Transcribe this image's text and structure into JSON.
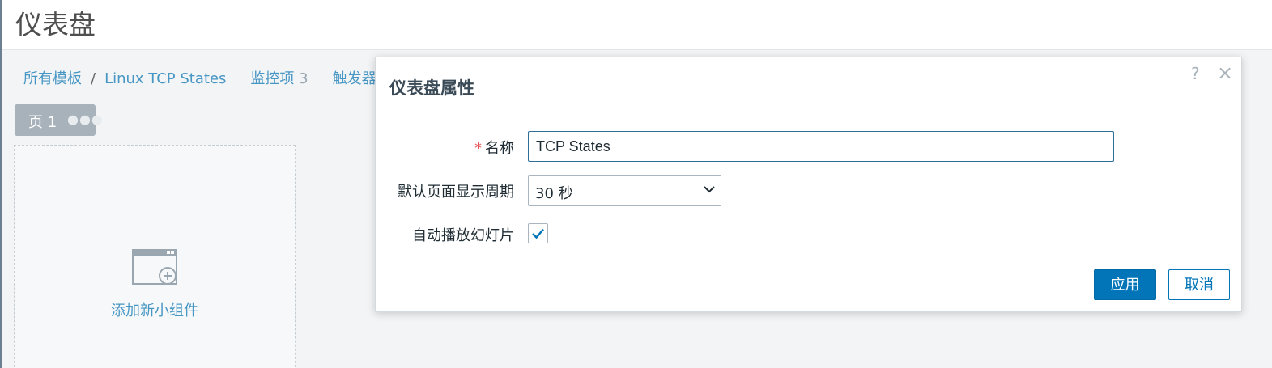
{
  "header": {
    "title": "仪表盘"
  },
  "breadcrumb": {
    "root": "所有模板",
    "separator": "/",
    "template": "Linux TCP States",
    "items_label": "监控项",
    "items_count": "3",
    "triggers_label": "触发器"
  },
  "page_tab": {
    "label": "页 1",
    "menu_icon": "ellipsis-icon"
  },
  "widget_placeholder": {
    "label": "添加新小组件",
    "icon": "add-widget-icon"
  },
  "dialog": {
    "title": "仪表盘属性",
    "help_icon": "?",
    "close_icon": "×",
    "form": {
      "name_label": "名称",
      "required_mark": "*",
      "name_value": "TCP States",
      "period_label": "默认页面显示周期",
      "period_value": "30 秒",
      "slideshow_label": "自动播放幻灯片",
      "slideshow_checked": true
    },
    "buttons": {
      "apply": "应用",
      "cancel": "取消"
    }
  },
  "colors": {
    "accent": "#0275b8",
    "link": "#4796c4",
    "required": "#e45959"
  }
}
